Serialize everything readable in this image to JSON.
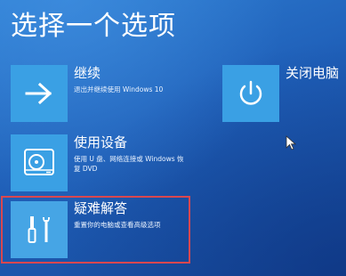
{
  "page": {
    "title": "选择一个选项"
  },
  "options": {
    "continue": {
      "icon": "arrow-right-icon",
      "title": "继续",
      "description": "退出并继续使用 Windows 10"
    },
    "device": {
      "icon": "disc-drive-icon",
      "title": "使用设备",
      "description": "使用 U 盘、网络连接或 Windows 恢复 DVD"
    },
    "troubleshoot": {
      "icon": "tools-icon",
      "title": "疑难解答",
      "description": "重置你的电脑或查看高级选项"
    },
    "shutdown": {
      "icon": "power-icon",
      "title": "关闭电脑"
    }
  },
  "colors": {
    "background": "#1f5fb8",
    "tile": "#3aa0e4",
    "highlight": "#d9474f"
  }
}
